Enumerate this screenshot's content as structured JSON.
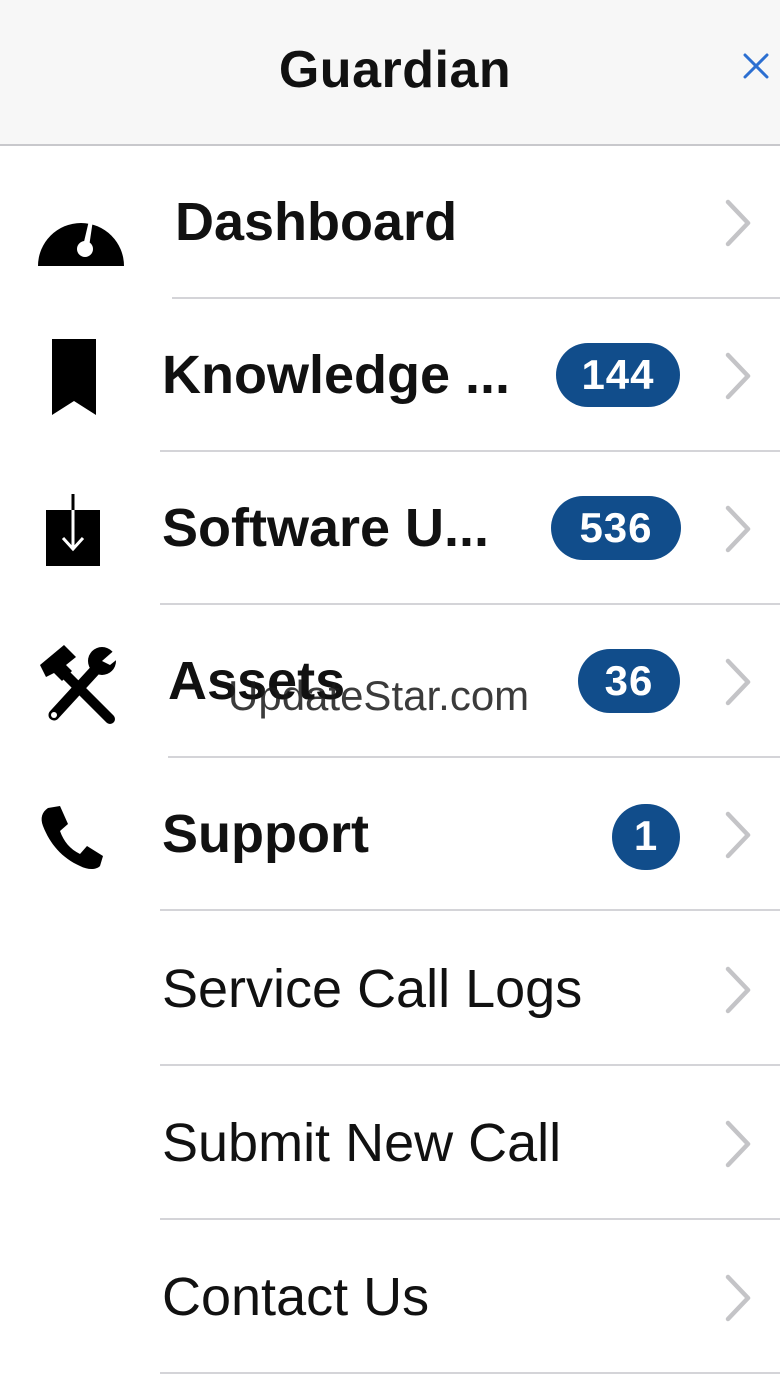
{
  "header": {
    "title": "Guardian",
    "close_icon": "close-icon"
  },
  "menu": {
    "items": [
      {
        "label": "Dashboard",
        "icon": "dashboard-gauge-icon",
        "badge": null,
        "weight": "bold"
      },
      {
        "label": "Knowledge ...",
        "icon": "bookmark-icon",
        "badge": "144",
        "weight": "bold"
      },
      {
        "label": "Software U...",
        "icon": "download-box-icon",
        "badge": "536",
        "weight": "bold"
      },
      {
        "label": "Assets",
        "icon": "tools-icon",
        "badge": "36",
        "weight": "bold"
      },
      {
        "label": "Support",
        "icon": "phone-icon",
        "badge": "1",
        "weight": "bold"
      },
      {
        "label": "Service Call Logs",
        "icon": null,
        "badge": null,
        "weight": "regular"
      },
      {
        "label": "Submit New Call",
        "icon": null,
        "badge": null,
        "weight": "regular"
      },
      {
        "label": "Contact Us",
        "icon": null,
        "badge": null,
        "weight": "regular"
      }
    ]
  },
  "watermark": "UpdateStar.com",
  "colors": {
    "badge_bg": "#114d8b",
    "badge_text": "#ffffff",
    "chevron": "#c4c4c7",
    "close_icon": "#2c6fd1",
    "header_bg": "#f7f7f7"
  }
}
